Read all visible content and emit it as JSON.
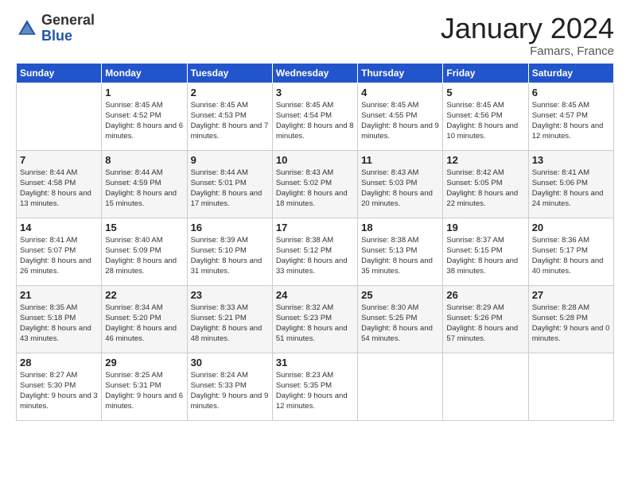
{
  "logo": {
    "general": "General",
    "blue": "Blue"
  },
  "title": "January 2024",
  "location": "Famars, France",
  "header": {
    "days": [
      "Sunday",
      "Monday",
      "Tuesday",
      "Wednesday",
      "Thursday",
      "Friday",
      "Saturday"
    ]
  },
  "weeks": [
    [
      {
        "day": "",
        "sunrise": "",
        "sunset": "",
        "daylight": ""
      },
      {
        "day": "1",
        "sunrise": "Sunrise: 8:45 AM",
        "sunset": "Sunset: 4:52 PM",
        "daylight": "Daylight: 8 hours and 6 minutes."
      },
      {
        "day": "2",
        "sunrise": "Sunrise: 8:45 AM",
        "sunset": "Sunset: 4:53 PM",
        "daylight": "Daylight: 8 hours and 7 minutes."
      },
      {
        "day": "3",
        "sunrise": "Sunrise: 8:45 AM",
        "sunset": "Sunset: 4:54 PM",
        "daylight": "Daylight: 8 hours and 8 minutes."
      },
      {
        "day": "4",
        "sunrise": "Sunrise: 8:45 AM",
        "sunset": "Sunset: 4:55 PM",
        "daylight": "Daylight: 8 hours and 9 minutes."
      },
      {
        "day": "5",
        "sunrise": "Sunrise: 8:45 AM",
        "sunset": "Sunset: 4:56 PM",
        "daylight": "Daylight: 8 hours and 10 minutes."
      },
      {
        "day": "6",
        "sunrise": "Sunrise: 8:45 AM",
        "sunset": "Sunset: 4:57 PM",
        "daylight": "Daylight: 8 hours and 12 minutes."
      }
    ],
    [
      {
        "day": "7",
        "sunrise": "Sunrise: 8:44 AM",
        "sunset": "Sunset: 4:58 PM",
        "daylight": "Daylight: 8 hours and 13 minutes."
      },
      {
        "day": "8",
        "sunrise": "Sunrise: 8:44 AM",
        "sunset": "Sunset: 4:59 PM",
        "daylight": "Daylight: 8 hours and 15 minutes."
      },
      {
        "day": "9",
        "sunrise": "Sunrise: 8:44 AM",
        "sunset": "Sunset: 5:01 PM",
        "daylight": "Daylight: 8 hours and 17 minutes."
      },
      {
        "day": "10",
        "sunrise": "Sunrise: 8:43 AM",
        "sunset": "Sunset: 5:02 PM",
        "daylight": "Daylight: 8 hours and 18 minutes."
      },
      {
        "day": "11",
        "sunrise": "Sunrise: 8:43 AM",
        "sunset": "Sunset: 5:03 PM",
        "daylight": "Daylight: 8 hours and 20 minutes."
      },
      {
        "day": "12",
        "sunrise": "Sunrise: 8:42 AM",
        "sunset": "Sunset: 5:05 PM",
        "daylight": "Daylight: 8 hours and 22 minutes."
      },
      {
        "day": "13",
        "sunrise": "Sunrise: 8:41 AM",
        "sunset": "Sunset: 5:06 PM",
        "daylight": "Daylight: 8 hours and 24 minutes."
      }
    ],
    [
      {
        "day": "14",
        "sunrise": "Sunrise: 8:41 AM",
        "sunset": "Sunset: 5:07 PM",
        "daylight": "Daylight: 8 hours and 26 minutes."
      },
      {
        "day": "15",
        "sunrise": "Sunrise: 8:40 AM",
        "sunset": "Sunset: 5:09 PM",
        "daylight": "Daylight: 8 hours and 28 minutes."
      },
      {
        "day": "16",
        "sunrise": "Sunrise: 8:39 AM",
        "sunset": "Sunset: 5:10 PM",
        "daylight": "Daylight: 8 hours and 31 minutes."
      },
      {
        "day": "17",
        "sunrise": "Sunrise: 8:38 AM",
        "sunset": "Sunset: 5:12 PM",
        "daylight": "Daylight: 8 hours and 33 minutes."
      },
      {
        "day": "18",
        "sunrise": "Sunrise: 8:38 AM",
        "sunset": "Sunset: 5:13 PM",
        "daylight": "Daylight: 8 hours and 35 minutes."
      },
      {
        "day": "19",
        "sunrise": "Sunrise: 8:37 AM",
        "sunset": "Sunset: 5:15 PM",
        "daylight": "Daylight: 8 hours and 38 minutes."
      },
      {
        "day": "20",
        "sunrise": "Sunrise: 8:36 AM",
        "sunset": "Sunset: 5:17 PM",
        "daylight": "Daylight: 8 hours and 40 minutes."
      }
    ],
    [
      {
        "day": "21",
        "sunrise": "Sunrise: 8:35 AM",
        "sunset": "Sunset: 5:18 PM",
        "daylight": "Daylight: 8 hours and 43 minutes."
      },
      {
        "day": "22",
        "sunrise": "Sunrise: 8:34 AM",
        "sunset": "Sunset: 5:20 PM",
        "daylight": "Daylight: 8 hours and 46 minutes."
      },
      {
        "day": "23",
        "sunrise": "Sunrise: 8:33 AM",
        "sunset": "Sunset: 5:21 PM",
        "daylight": "Daylight: 8 hours and 48 minutes."
      },
      {
        "day": "24",
        "sunrise": "Sunrise: 8:32 AM",
        "sunset": "Sunset: 5:23 PM",
        "daylight": "Daylight: 8 hours and 51 minutes."
      },
      {
        "day": "25",
        "sunrise": "Sunrise: 8:30 AM",
        "sunset": "Sunset: 5:25 PM",
        "daylight": "Daylight: 8 hours and 54 minutes."
      },
      {
        "day": "26",
        "sunrise": "Sunrise: 8:29 AM",
        "sunset": "Sunset: 5:26 PM",
        "daylight": "Daylight: 8 hours and 57 minutes."
      },
      {
        "day": "27",
        "sunrise": "Sunrise: 8:28 AM",
        "sunset": "Sunset: 5:28 PM",
        "daylight": "Daylight: 9 hours and 0 minutes."
      }
    ],
    [
      {
        "day": "28",
        "sunrise": "Sunrise: 8:27 AM",
        "sunset": "Sunset: 5:30 PM",
        "daylight": "Daylight: 9 hours and 3 minutes."
      },
      {
        "day": "29",
        "sunrise": "Sunrise: 8:25 AM",
        "sunset": "Sunset: 5:31 PM",
        "daylight": "Daylight: 9 hours and 6 minutes."
      },
      {
        "day": "30",
        "sunrise": "Sunrise: 8:24 AM",
        "sunset": "Sunset: 5:33 PM",
        "daylight": "Daylight: 9 hours and 9 minutes."
      },
      {
        "day": "31",
        "sunrise": "Sunrise: 8:23 AM",
        "sunset": "Sunset: 5:35 PM",
        "daylight": "Daylight: 9 hours and 12 minutes."
      },
      {
        "day": "",
        "sunrise": "",
        "sunset": "",
        "daylight": ""
      },
      {
        "day": "",
        "sunrise": "",
        "sunset": "",
        "daylight": ""
      },
      {
        "day": "",
        "sunrise": "",
        "sunset": "",
        "daylight": ""
      }
    ]
  ]
}
